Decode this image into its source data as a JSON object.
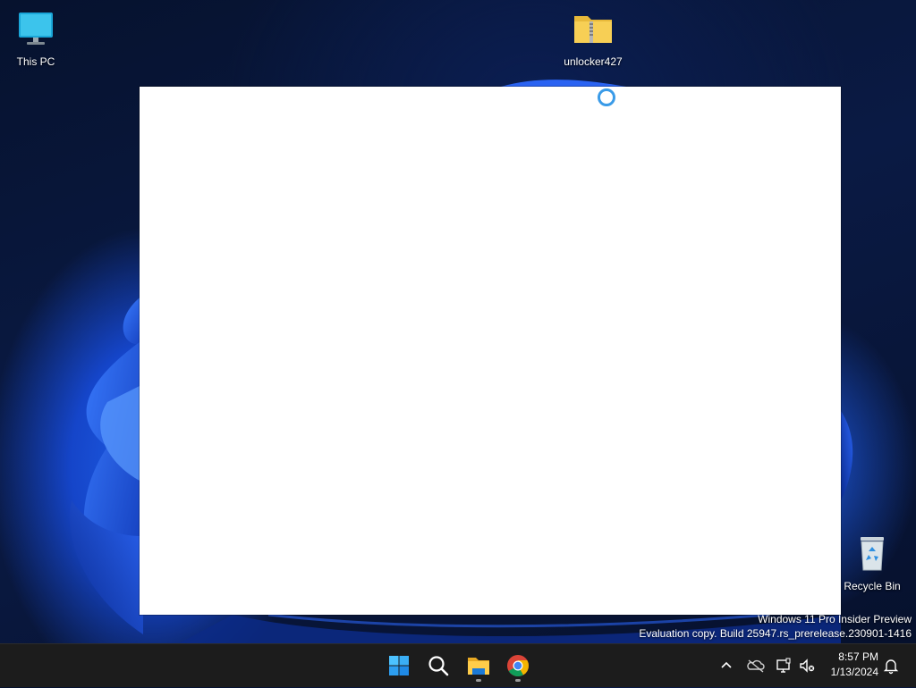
{
  "desktop": {
    "icons": [
      {
        "label": "This PC",
        "icon": "monitor-icon"
      },
      {
        "label": "unlocker427",
        "icon": "zip-folder-icon"
      },
      {
        "label": "Recycle Bin",
        "icon": "recycle-bin-icon"
      }
    ],
    "watermark": {
      "line1": "Windows 11 Pro Insider Preview",
      "line2": "Evaluation copy. Build 25947.rs_prerelease.230901-1416"
    }
  },
  "window": {
    "state": "loading",
    "icon": "busy-spinner-icon"
  },
  "taskbar": {
    "pinned": [
      {
        "name": "Start",
        "icon": "windows-start-icon"
      },
      {
        "name": "Search",
        "icon": "search-icon"
      },
      {
        "name": "File Explorer",
        "icon": "file-explorer-icon",
        "running": true
      },
      {
        "name": "Google Chrome",
        "icon": "chrome-icon",
        "running": true
      }
    ],
    "tray": {
      "icons": [
        "chevron-up-icon",
        "onedrive-icon",
        "network-icon",
        "volume-muted-icon",
        "notification-bell-icon"
      ],
      "time": "8:57 PM",
      "date": "1/13/2024"
    }
  },
  "colors": {
    "accent": "#3a9be8",
    "taskbar": "#1c1c1c",
    "window": "#ffffff"
  }
}
